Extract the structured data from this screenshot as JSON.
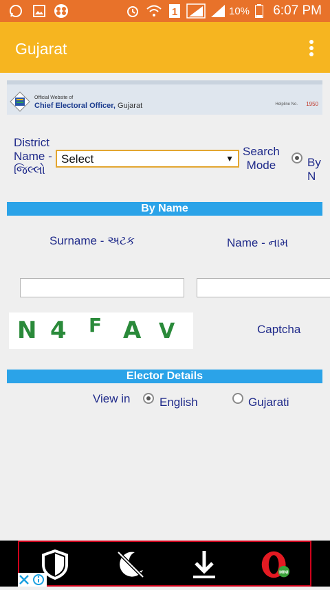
{
  "status_bar": {
    "battery": "10%",
    "time": "6:07 PM",
    "sim": "1"
  },
  "app": {
    "title": "Gujarat"
  },
  "banner": {
    "small": "Official Website of",
    "big": "Chief Electoral Officer,",
    "big_suffix": "Gujarat",
    "helpline": "Helpline No.",
    "number": "1950"
  },
  "district": {
    "label_1": "District",
    "label_2": "Name -",
    "label_3": "જિલ્લો",
    "value": "Select"
  },
  "search_mode": {
    "label_1": "Search",
    "label_2": "Mode",
    "option": "By N"
  },
  "by_name": {
    "header": "By Name",
    "surname_label": "Surname - અટક",
    "name_label": "Name - નામ",
    "surname_value": "",
    "name_value": ""
  },
  "captcha": {
    "chars": [
      "N",
      "4",
      "F",
      "A",
      "V"
    ],
    "label": "Captcha"
  },
  "elector": {
    "header": "Elector Details",
    "view_in": "View in",
    "opt_english": "English",
    "opt_gujarati": "Gujarati"
  },
  "ad": {
    "icons": [
      "shield-icon",
      "moon-icon",
      "download-icon",
      "opera-mini-icon"
    ],
    "mini_label": "MINI"
  },
  "colors": {
    "status": "#e8722a",
    "appbar": "#f6b520",
    "section": "#2ba3e8",
    "text": "#1f2a8a"
  }
}
